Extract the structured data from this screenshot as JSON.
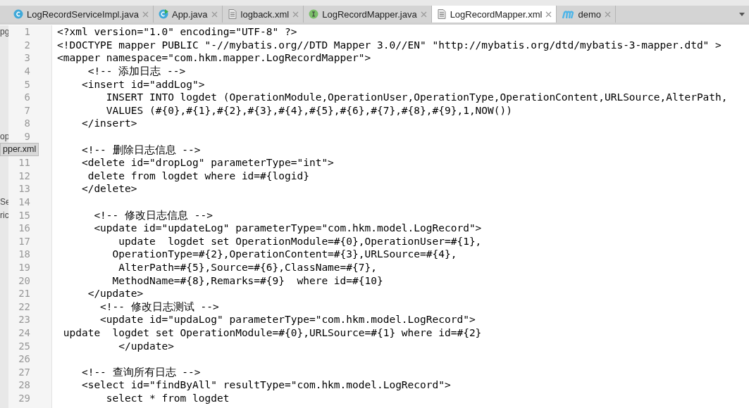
{
  "tabs": [
    {
      "label": "LogRecordServiceImpl.java",
      "kind": "class",
      "selected": false
    },
    {
      "label": "App.java",
      "kind": "run",
      "selected": false
    },
    {
      "label": "logback.xml",
      "kind": "file",
      "selected": false
    },
    {
      "label": "LogRecordMapper.java",
      "kind": "interface",
      "selected": false
    },
    {
      "label": "LogRecordMapper.xml",
      "kind": "file",
      "selected": true
    },
    {
      "label": "demo",
      "kind": "maven",
      "selected": false
    }
  ],
  "lines": [
    {
      "number": "1",
      "text": "<?xml version=\"1.0\" encoding=\"UTF-8\" ?>",
      "side": "pg"
    },
    {
      "number": "2",
      "text": "<!DOCTYPE mapper PUBLIC \"-//mybatis.org//DTD Mapper 3.0//EN\" \"http://mybatis.org/dtd/mybatis-3-mapper.dtd\" >"
    },
    {
      "number": "3",
      "text": "<mapper namespace=\"com.hkm.mapper.LogRecordMapper\">"
    },
    {
      "number": "4",
      "text": "     <!-- 添加日志 -->"
    },
    {
      "number": "5",
      "text": "    <insert id=\"addLog\">"
    },
    {
      "number": "6",
      "text": "        INSERT INTO logdet (OperationModule,OperationUser,OperationType,OperationContent,URLSource,AlterPath,"
    },
    {
      "number": "7",
      "text": "        VALUES (#{0},#{1},#{2},#{3},#{4},#{5},#{6},#{7},#{8},#{9},1,NOW())"
    },
    {
      "number": "8",
      "text": "    </insert>"
    },
    {
      "number": "9",
      "side": "op"
    },
    {
      "text": "    <!-- 删除日志信息 -->",
      "tooltip": "pper.xml"
    },
    {
      "number": "11",
      "text": "    <delete id=\"dropLog\" parameterType=\"int\">"
    },
    {
      "number": "12",
      "text": "     delete from logdet where id=#{logid}"
    },
    {
      "number": "13",
      "text": "    </delete>"
    },
    {
      "number": "14",
      "side": "Se"
    },
    {
      "number": "15",
      "text": "      <!-- 修改日志信息 -->",
      "side": "ric"
    },
    {
      "number": "16",
      "text": "      <update id=\"updateLog\" parameterType=\"com.hkm.model.LogRecord\">"
    },
    {
      "number": "17",
      "text": "          update  logdet set OperationModule=#{0},OperationUser=#{1},"
    },
    {
      "number": "18",
      "text": "         OperationType=#{2},OperationContent=#{3},URLSource=#{4},"
    },
    {
      "number": "19",
      "text": "          AlterPath=#{5},Source=#{6},ClassName=#{7},"
    },
    {
      "number": "20",
      "text": "         MethodName=#{8},Remarks=#{9}  where id=#{10}"
    },
    {
      "number": "21",
      "text": "     </update>"
    },
    {
      "number": "22",
      "text": "       <!-- 修改日志测试 -->"
    },
    {
      "number": "23",
      "text": "       <update id=\"updaLog\" parameterType=\"com.hkm.model.LogRecord\">"
    },
    {
      "number": "24",
      "text": " update  logdet set OperationModule=#{0},URLSource=#{1} where id=#{2}"
    },
    {
      "number": "25",
      "text": "          </update>"
    },
    {
      "number": "26"
    },
    {
      "number": "27",
      "text": "    <!-- 查询所有日志 -->"
    },
    {
      "number": "28",
      "text": "    <select id=\"findByAll\" resultType=\"com.hkm.model.LogRecord\">"
    },
    {
      "number": "29",
      "text": "        select * from logdet"
    }
  ]
}
